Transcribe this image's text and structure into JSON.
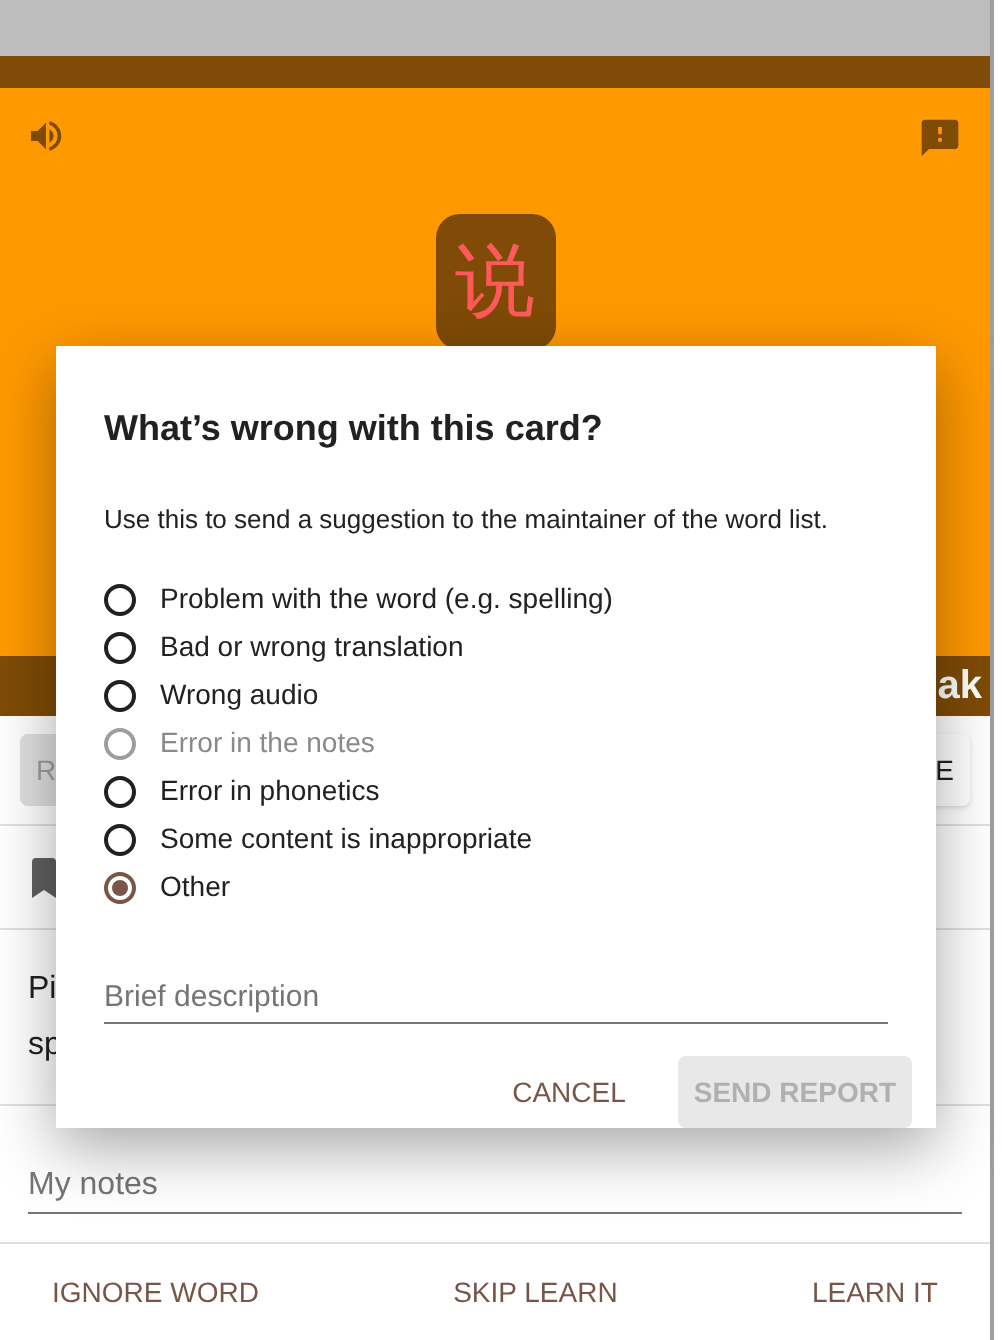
{
  "card": {
    "character": "说",
    "band_text": "ak",
    "left_button": "R",
    "right_button": "E",
    "text_lines": [
      "Pi",
      "sp"
    ],
    "notes_field": {
      "placeholder": "My notes"
    }
  },
  "actions": [
    "IGNORE WORD",
    "SKIP LEARN",
    "LEARN IT"
  ],
  "dialog": {
    "title": "What’s wrong with this card?",
    "description": "Use this to send a suggestion to the maintainer of the word list.",
    "options": [
      {
        "label": "Problem with the word (e.g. spelling)",
        "selected": false,
        "disabled": false
      },
      {
        "label": "Bad or wrong translation",
        "selected": false,
        "disabled": false
      },
      {
        "label": "Wrong audio",
        "selected": false,
        "disabled": false
      },
      {
        "label": "Error in the notes",
        "selected": false,
        "disabled": true
      },
      {
        "label": "Error in phonetics",
        "selected": false,
        "disabled": false
      },
      {
        "label": "Some content is inappropriate",
        "selected": false,
        "disabled": false
      },
      {
        "label": "Other",
        "selected": true,
        "disabled": false
      }
    ],
    "description_field": {
      "placeholder": "Brief description"
    },
    "cancel": "CANCEL",
    "send": {
      "label": "SEND REPORT",
      "disabled": true
    }
  }
}
